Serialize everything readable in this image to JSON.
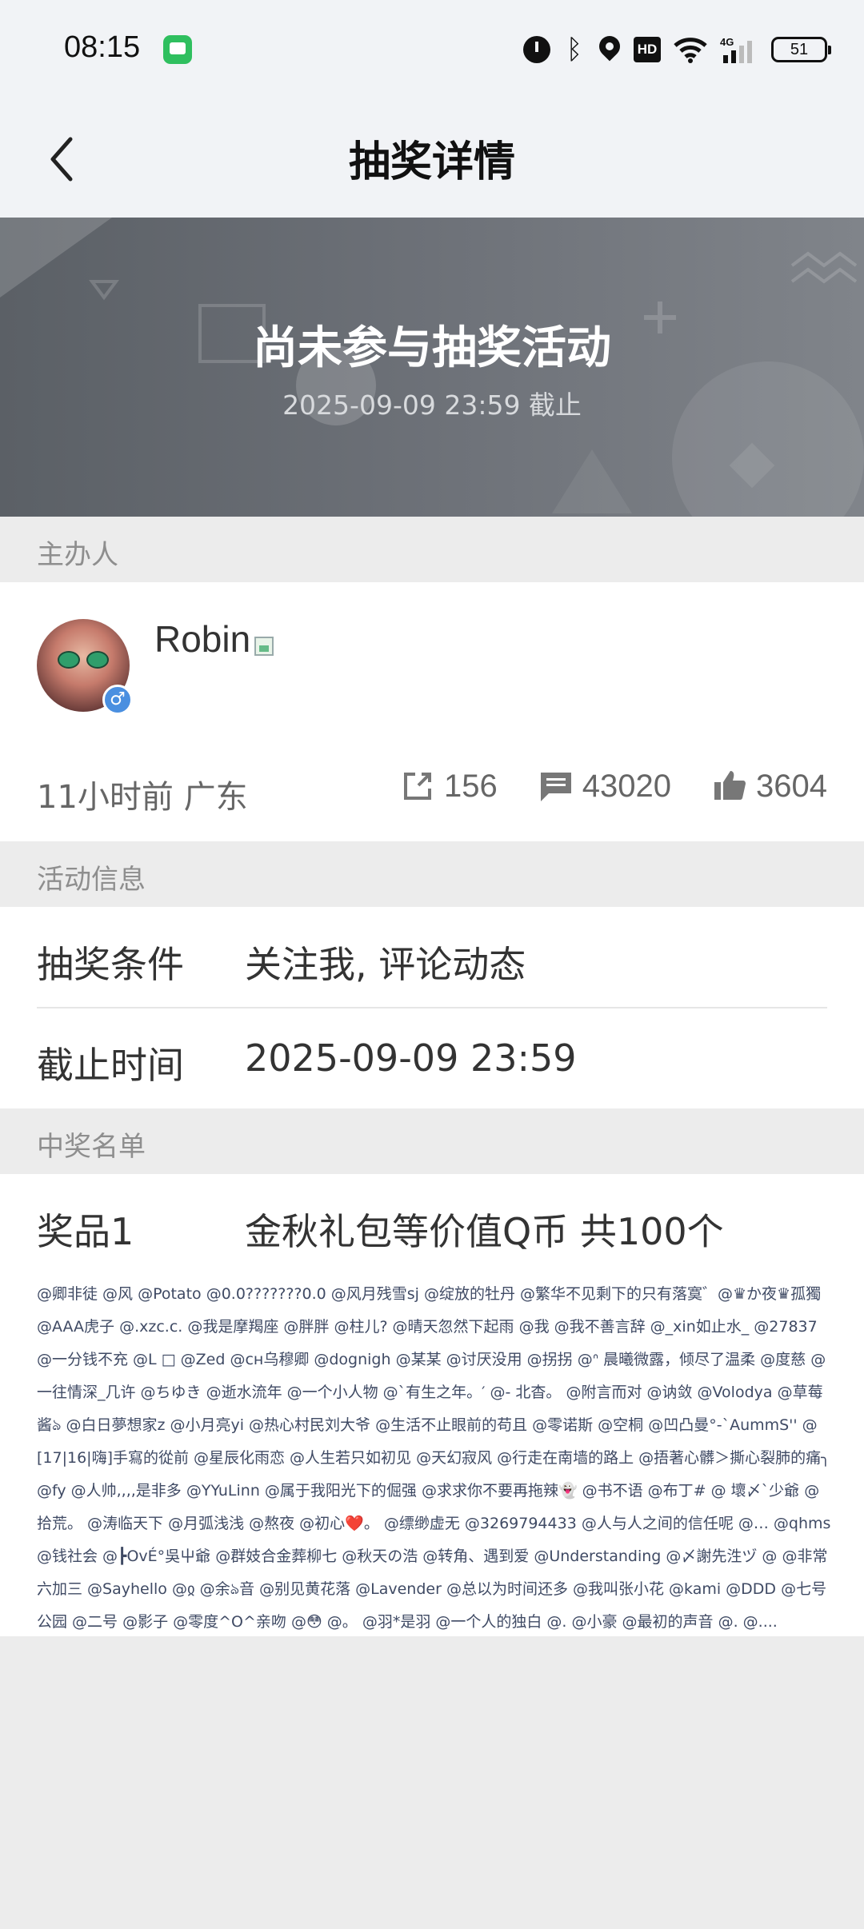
{
  "status_bar": {
    "time": "08:15",
    "network": "4G",
    "hd_label": "HD",
    "battery": "51"
  },
  "header": {
    "title": "抽奖详情"
  },
  "banner": {
    "status": "尚未参与抽奖活动",
    "deadline": "2025-09-09 23:59 截止"
  },
  "organizer_section": {
    "label": "主办人",
    "name": "Robin",
    "gender_symbol": "♂",
    "time_location": "11小时前 广东",
    "shares": "156",
    "comments": "43020",
    "likes": "3604"
  },
  "activity_section": {
    "label": "活动信息",
    "rows": [
      {
        "label": "抽奖条件",
        "value": "关注我, 评论动态"
      },
      {
        "label": "截止时间",
        "value": "2025-09-09 23:59"
      }
    ]
  },
  "winners_section": {
    "label": "中奖名单",
    "prize_label": "奖品1",
    "prize_value": "金秋礼包等价值Q币 共100个",
    "mentions": "@卿非徒 @风 @Potato @0.0???????0.0 @风月残雪sj @绽放的牡丹 @繁华不见剩下的只有落寞゛@♛か夜♛孤獨 @AAA虎子 @.xzc.c. @我是摩羯座 @胖胖 @柱儿? @晴天忽然下起雨 @我 @我不善言辞 @_xin如止水_ @27837 @一分钱不充 @L □ @Zed @сн乌穆卿 @dognigh @某某 @讨厌没用 @拐拐 @ᐢ 晨曦微露，倾尽了温柔 @度慈 @一往情深_几许 @ちゆき @逝水流年 @一个小人物 @`有生之年。′ @- 北杳。 @附言而对 @讷敛 @Volodya @草莓酱ঌ @白日夢想家z @小月亮yi @热心村民刘大爷 @生活不止眼前的苟且 @零诺斯 @空桐 @凹凸曼°-`AummS'' @[17|16|嗨]手寫的從前 @星辰化雨恋 @人生若只如初见 @天幻寂风 @行走在南墙的路上 @捂著心髒＞撕心裂肺的痛╮ @fy @人帅,,,,是非多 @YYuLinn @属于我阳光下的倔强 @求求你不要再拖辣👻 @书不语 @布丁# @ 壞〆`少爺 @拾荒。 @涛临天下 @月弧浅浅 @熬夜 @初心❤️。 @缥缈虚无 @3269794433 @人与人之间的信任呢 @… @qhms @钱社会 @┣OvÉ°吳屮爺 @群妓合金葬柳七 @秋天の浩 @转角、遇到爱 @Understanding @〆謝先泩ヅ @ @非常六加三 @Sayhello @ჲ @余ঌ音 @别见黄花落 @Lavender @总以为时间还多 @我叫张小花 @kami @DDD @七号公园 @二号 @影子 @零度^O^亲吻 @😳 @。 @羽*是羽 @一个人的独白 @. @小豪 @最初的声音 @. @...."
  }
}
